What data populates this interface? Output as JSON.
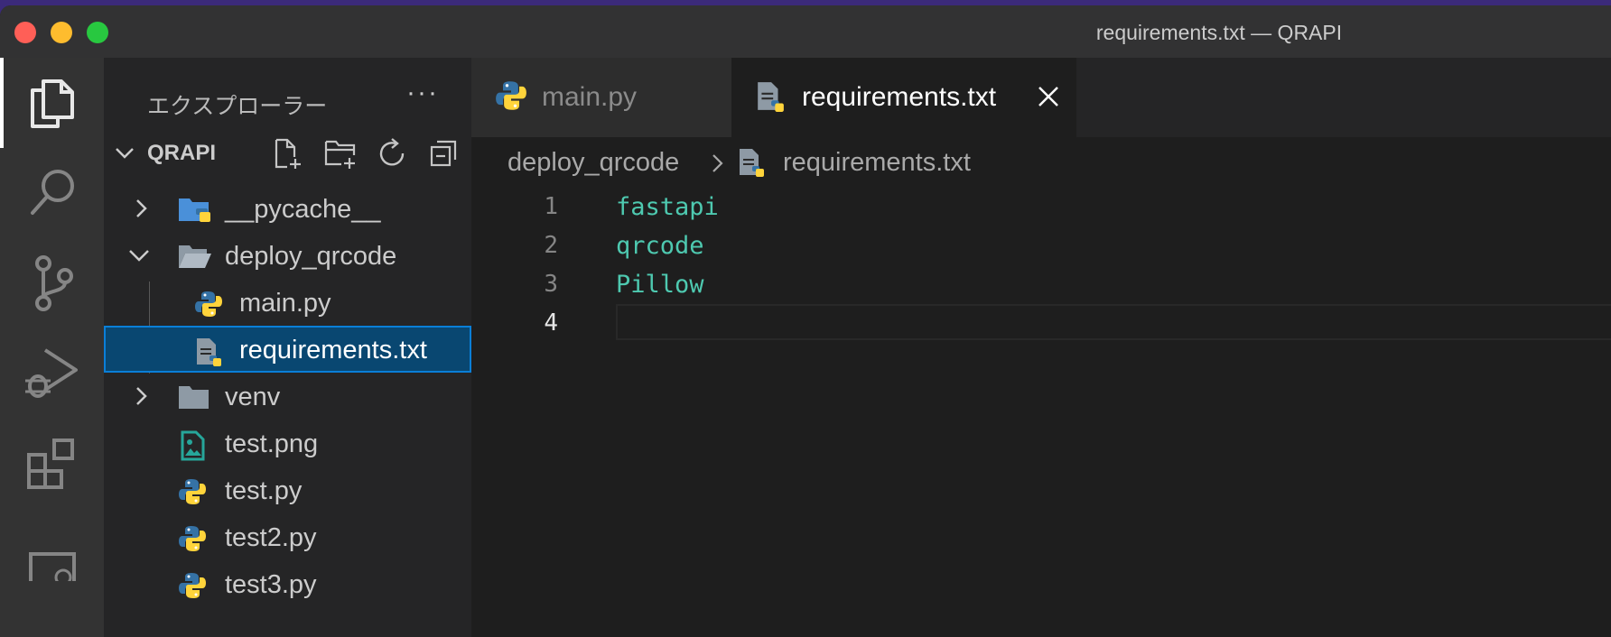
{
  "window": {
    "title": "requirements.txt — QRAPI"
  },
  "activity_bar": {
    "items": [
      {
        "name": "explorer-icon",
        "active": true
      },
      {
        "name": "search-icon",
        "active": false
      },
      {
        "name": "source-control-icon",
        "active": false
      },
      {
        "name": "run-debug-icon",
        "active": false
      },
      {
        "name": "extensions-icon",
        "active": false
      },
      {
        "name": "remote-explorer-icon",
        "active": false
      }
    ]
  },
  "sidebar": {
    "header": "エクスプローラー",
    "more": "···",
    "root": "QRAPI",
    "tree": [
      {
        "label": "__pycache__",
        "type": "folder",
        "expanded": false,
        "icon": "python-folder-icon"
      },
      {
        "label": "deploy_qrcode",
        "type": "folder",
        "expanded": true,
        "icon": "folder-open-icon"
      },
      {
        "label": "main.py",
        "type": "file",
        "icon": "python-icon"
      },
      {
        "label": "requirements.txt",
        "type": "file",
        "icon": "requirements-file-icon",
        "selected": true
      },
      {
        "label": "venv",
        "type": "folder",
        "expanded": false,
        "icon": "folder-icon"
      },
      {
        "label": "test.png",
        "type": "file",
        "icon": "image-file-icon"
      },
      {
        "label": "test.py",
        "type": "file",
        "icon": "python-icon"
      },
      {
        "label": "test2.py",
        "type": "file",
        "icon": "python-icon"
      },
      {
        "label": "test3.py",
        "type": "file",
        "icon": "python-icon"
      }
    ]
  },
  "tabs": [
    {
      "label": "main.py",
      "active": false
    },
    {
      "label": "requirements.txt",
      "active": true
    }
  ],
  "breadcrumb": {
    "folder": "deploy_qrcode",
    "separator": ">",
    "file": "requirements.txt"
  },
  "editor": {
    "lines": [
      {
        "number": "1",
        "text": "fastapi"
      },
      {
        "number": "2",
        "text": "qrcode"
      },
      {
        "number": "3",
        "text": "Pillow"
      },
      {
        "number": "4",
        "text": ""
      }
    ],
    "current_line": "4"
  },
  "colors": {
    "accent": "#0a7fd8",
    "selection": "#094771",
    "code_text": "#4ec9b0"
  }
}
